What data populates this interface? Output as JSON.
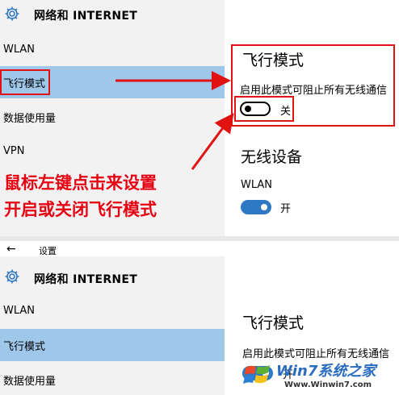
{
  "top": {
    "header": {
      "title": "网络和 INTERNET"
    },
    "nav": [
      "WLAN",
      "飞行模式",
      "数据使用量",
      "VPN"
    ],
    "airplane": {
      "title": "飞行模式",
      "desc": "启用此模式可阻止所有无线通信",
      "toggle_label": "关"
    },
    "wireless": {
      "title": "无线设备",
      "wlan_label": "WLAN",
      "wlan_toggle_label": "开"
    },
    "annotation": {
      "line1": "鼠标左键点击来设置",
      "line2": "开启或关闭飞行模式"
    }
  },
  "bottom": {
    "back_label": "设置",
    "header": {
      "title": "网络和 INTERNET"
    },
    "nav": [
      "WLAN",
      "飞行模式",
      "数据使用量"
    ],
    "airplane": {
      "title": "飞行模式",
      "desc": "启用此模式可阻止所有无线通信",
      "toggle_label": "开"
    }
  },
  "watermark": {
    "brand": "Win7系统之家",
    "url": "Www.Winwin7.com"
  },
  "colors": {
    "accent": "#2f78c4",
    "selected": "#9ec7ea",
    "annotation": "#e60012"
  }
}
